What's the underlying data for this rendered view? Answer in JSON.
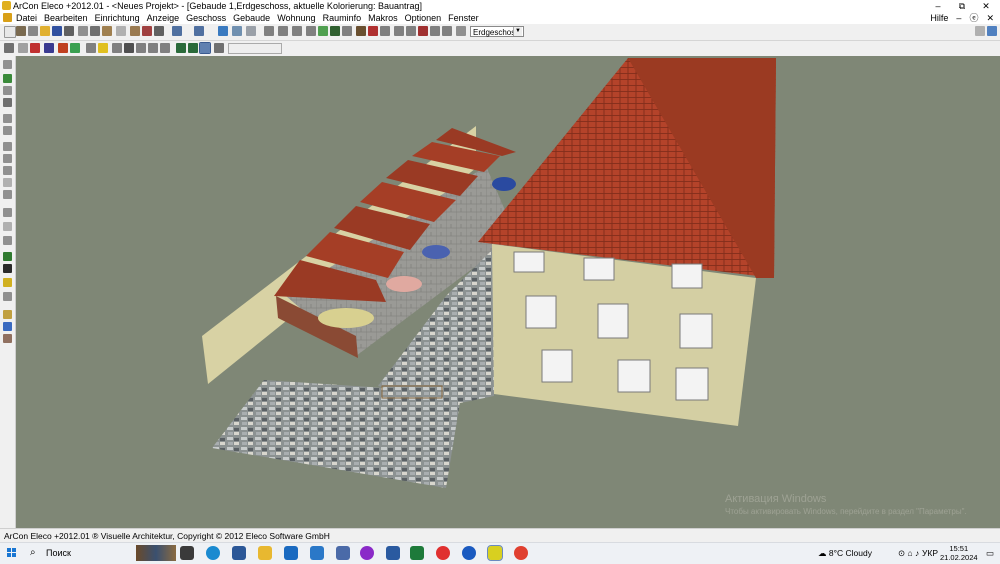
{
  "window": {
    "title": "ArCon Eleco  +2012.01  - <Neues Projekt> - [Gebaude 1,Erdgeschoss, aktuelle Kolorierung: Bauantrag]",
    "minimize": "–",
    "maximize": "⧉",
    "close": "✕"
  },
  "menu": {
    "items": [
      "Datei",
      "Bearbeiten",
      "Einrichtung",
      "Anzeige",
      "Geschoss",
      "Gebaude",
      "Wohnung",
      "Rauminfo",
      "Makros",
      "Optionen",
      "Fenster"
    ],
    "help": "Hilfe",
    "doc_minimize": "–",
    "doc_restore": "ⓔ",
    "doc_close": "✕"
  },
  "toolbar": {
    "floor_select": "Erdgeschoss"
  },
  "watermark": {
    "line1": "Активация Windows",
    "line2": "Чтобы активировать Windows, перейдите в раздел \"Параметры\"."
  },
  "status": {
    "text": "ArCon Eleco +2012.01 ® Visuelle Architektur, Copyright © 2012 Eleco Software GmbH"
  },
  "taskbar": {
    "search_placeholder": "Поиск",
    "weather": "8°C  Cloudy",
    "language": "УКР",
    "time": "15:51",
    "date": "21.02.2024"
  },
  "colors": {
    "viewport_bg": "#7f8776",
    "roof": "#b4432a",
    "wall": "#d4cfa3",
    "stone": "#9aa0a0"
  }
}
